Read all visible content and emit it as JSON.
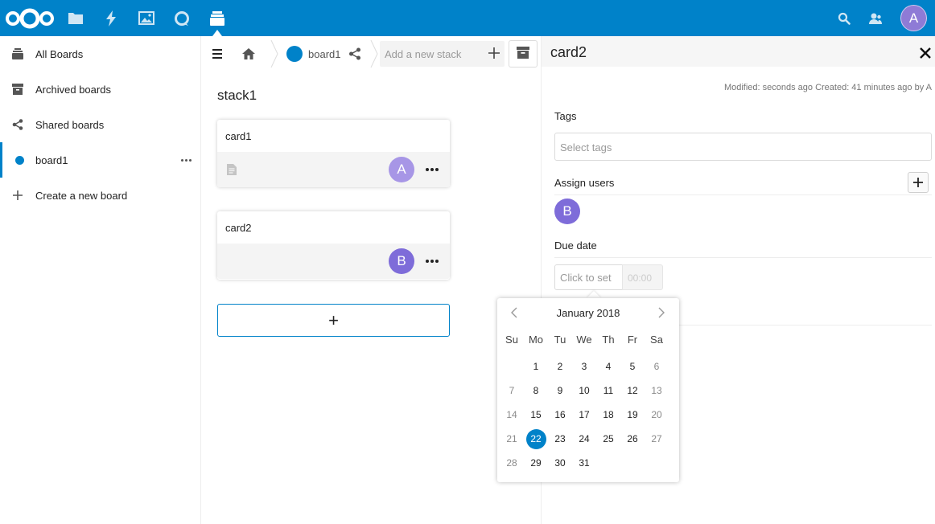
{
  "header": {
    "apps": [
      {
        "name": "files-icon"
      },
      {
        "name": "activity-icon"
      },
      {
        "name": "gallery-icon"
      },
      {
        "name": "talk-icon"
      },
      {
        "name": "deck-icon",
        "active": true
      }
    ],
    "user_initial": "A",
    "colors": {
      "brand": "#0082c9",
      "avatar_a": "#8e7bd6"
    }
  },
  "navigation": {
    "items": [
      {
        "label": "All Boards",
        "icon": "stack-icon"
      },
      {
        "label": "Archived boards",
        "icon": "archive-icon"
      },
      {
        "label": "Shared boards",
        "icon": "share-icon"
      },
      {
        "label": "board1",
        "icon": "board-color-dot",
        "active": true
      },
      {
        "label": "Create a new board",
        "icon": "plus-icon"
      }
    ]
  },
  "toolbar": {
    "board_name": "board1",
    "add_stack_placeholder": "Add a new stack"
  },
  "stack": {
    "title": "stack1",
    "cards": [
      {
        "title": "card1",
        "has_description": true,
        "assignee": "A"
      },
      {
        "title": "card2",
        "has_description": false,
        "assignee": "B"
      }
    ],
    "add_card_symbol": "+"
  },
  "sidebar": {
    "title": "card2",
    "meta": "Modified: seconds ago Created: 41 minutes ago by A",
    "tags_label": "Tags",
    "tags_placeholder": "Select tags",
    "assign_label": "Assign users",
    "assign_add_symbol": "+",
    "assigned_user": "B",
    "due_label": "Due date",
    "due_date_placeholder": "Click to set",
    "due_time_placeholder": "00:00"
  },
  "datepicker": {
    "month_label": "January 2018",
    "weekdays": [
      "Su",
      "Mo",
      "Tu",
      "We",
      "Th",
      "Fr",
      "Sa"
    ],
    "start_offset": 1,
    "days_in_month": 31,
    "selected_day": 22
  }
}
